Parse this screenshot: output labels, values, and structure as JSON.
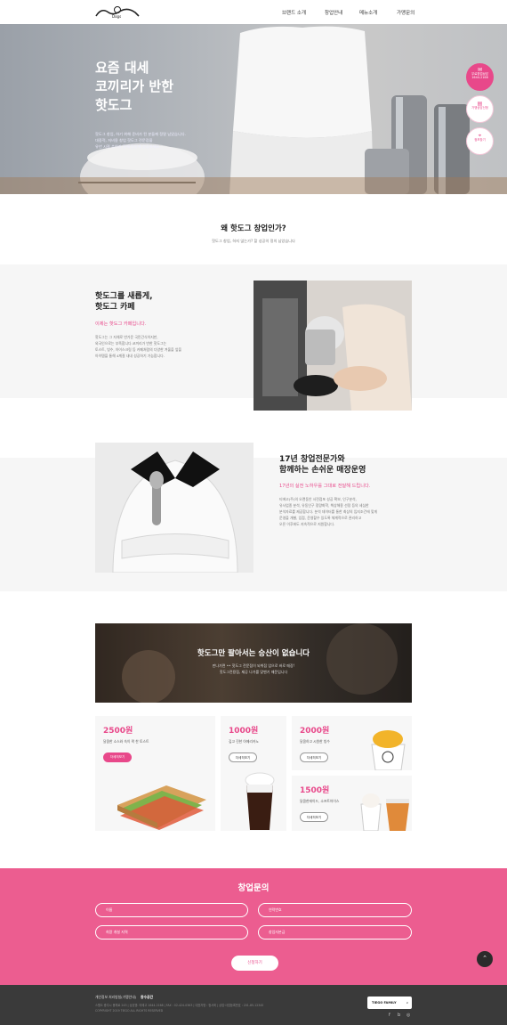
{
  "header": {
    "logo_text": "Dogs",
    "nav": [
      "브랜드 소개",
      "창업안내",
      "메뉴소개",
      "가맹문의"
    ]
  },
  "hero": {
    "title_lines": [
      "요즘 대세",
      "코끼리가 반한",
      "핫도그"
    ],
    "desc_lines": [
      "핫도그 창업, 하기 위해 준비가 된 분들께 정말 남았습니다.",
      "대중적, 저비용 창업 핫도그 전문점을",
      "유년 시절 추억과 함께 맛있게 성공하세요."
    ]
  },
  "fabs": [
    {
      "label": "무료창업상담",
      "sub": "1644-2168"
    },
    {
      "label": "가맹상담신청"
    },
    {
      "label": "점포찾기"
    }
  ],
  "why": {
    "title": "왜 핫도그 창업인가?",
    "subtitle": "핫도그 창업, 하지 않는가? 할 성공의 정의 남았습니다"
  },
  "feature1": {
    "title_lines": [
      "핫도그를 새롭게,",
      "핫도그 카페"
    ],
    "highlight": "이제는 핫도그 카페입니다.",
    "body_lines": [
      "핫도그는 그 자체로 반가운 국민간식이지만,",
      "외국인으로는 부족합니다.코끼리가 반한 핫도그는",
      "토스트, 빙수, 아이스크림 등 카페처럼의 다양한 겨울을 앞을",
      "아이템을 통해 4계절 내내 성공하기 가능합니다."
    ]
  },
  "feature2": {
    "title_lines": [
      "17년 창업전문가와",
      "함께하는 손쉬운 매장운영"
    ],
    "highlight": "17년의 실전 노하우를 그대로 전달해 드립니다.",
    "body_lines": [
      "티에고(주)의 오랜동안 사전점포 성공 확보, 인구분석,",
      "유사업종 분석, 유동인구 정량화학, 책상해용 선정 등의 세심한",
      "분석자료를 제공합니다. 분석 데이터를 통한 최상의 입지조건에 맞게",
      "운영을 개별, 입점, 운영할수 있도록 체계적으로 관리하고",
      "오픈 이후에도 지속적으로 지원합니다."
    ]
  },
  "promo": {
    "title": "핫도그만 팔아서는 승산이 없습니다",
    "desc_lines": [
      "판나가면 •• 핫도그 전문점이 되취점 업으로 바로 매장!",
      "핫도그전용점, 제공 나가를 맞벤기 때문입니다"
    ]
  },
  "menu": [
    {
      "price": "2500원",
      "desc": "달콤한 소스와 속이 꽉 찬 토스트",
      "button": "자세히보기"
    },
    {
      "price": "1000원",
      "desc": "깊고 진한 아메리카노",
      "button": "자세히보기"
    },
    {
      "price": "2000원",
      "desc": "달콤하고 시원한 빙수",
      "button": "자세히보기"
    },
    {
      "price": "1500원",
      "desc": "달콤한에이드, 소프트아이스",
      "button": "자세히보기"
    }
  ],
  "inquiry": {
    "title": "창업문의",
    "fields": [
      "이름",
      "연락번호",
      "희망 개설 지역",
      "창업자본금"
    ],
    "submit": "신청하기"
  },
  "footer": {
    "links": [
      "개인정보 처리방침(가맹안내)",
      "창수공간"
    ],
    "info_lines": [
      "스펠도 충주시 봉채로 243 | 상호명: 티에고 1644-2168 | FAX : 02-424-0363 | 대표자명 : 정서희 | 상업·사업등록번호 : 201-85-12345",
      "COPYRIGHT 2019 TIEGO ALL RIGHTS RESERVED"
    ],
    "brand": "TIEGO FAMILY",
    "social": [
      "f",
      "b",
      "◎"
    ]
  },
  "colors": {
    "accent": "#e8488a",
    "inquiry_bg": "#ec5d90",
    "footer_bg": "#3a3a3a"
  }
}
